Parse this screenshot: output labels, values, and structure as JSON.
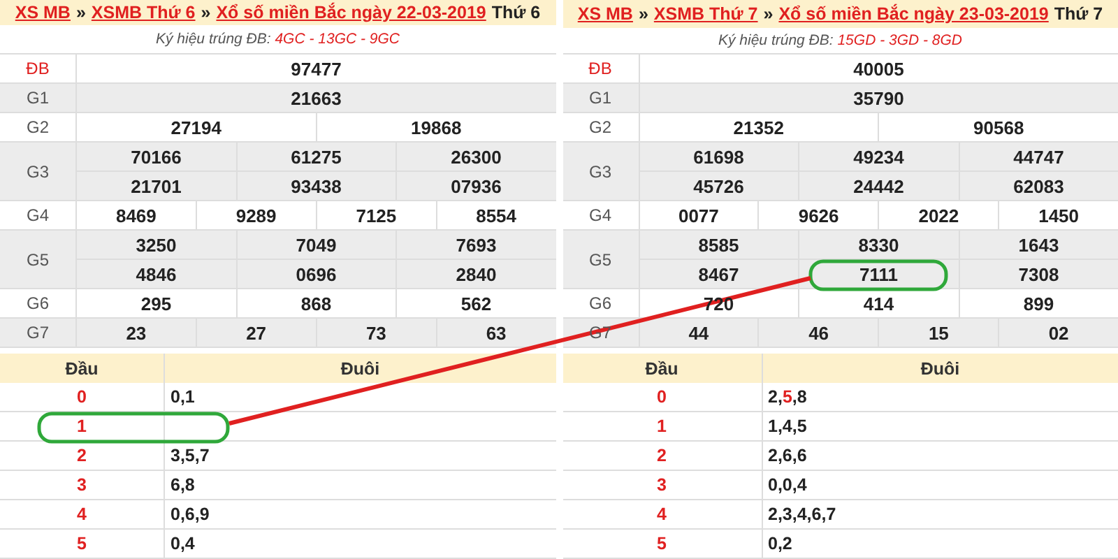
{
  "panels": [
    {
      "breadcrumb": [
        {
          "kind": "link",
          "text": "XS MB"
        },
        {
          "kind": "sep",
          "text": "»"
        },
        {
          "kind": "link",
          "text": "XSMB Thứ 6"
        },
        {
          "kind": "sep",
          "text": "»"
        },
        {
          "kind": "link",
          "text": "Xổ số miền Bắc ngày 22-03-2019"
        },
        {
          "kind": "text",
          "text": "Thứ 6"
        }
      ],
      "code_label": "Ký hiệu trúng ĐB:",
      "codes": "4GC - 13GC - 9GC",
      "prizes": [
        {
          "name": "ĐB",
          "kind": "special",
          "lines": [
            [
              "97477"
            ]
          ]
        },
        {
          "name": "G1",
          "kind": "normal",
          "lines": [
            [
              "21663"
            ]
          ]
        },
        {
          "name": "G2",
          "kind": "normal",
          "lines": [
            [
              "27194",
              "19868"
            ]
          ]
        },
        {
          "name": "G3",
          "kind": "normal",
          "lines": [
            [
              "70166",
              "61275",
              "26300"
            ],
            [
              "21701",
              "93438",
              "07936"
            ]
          ]
        },
        {
          "name": "G4",
          "kind": "normal",
          "lines": [
            [
              "8469",
              "9289",
              "7125",
              "8554"
            ]
          ]
        },
        {
          "name": "G5",
          "kind": "normal",
          "lines": [
            [
              "3250",
              "7049",
              "7693"
            ],
            [
              "4846",
              "0696",
              "2840"
            ]
          ]
        },
        {
          "name": "G6",
          "kind": "normal",
          "lines": [
            [
              "295",
              "868",
              "562"
            ]
          ]
        },
        {
          "name": "G7",
          "kind": "normal",
          "lines": [
            [
              "23",
              "27",
              "73",
              "63"
            ]
          ]
        }
      ],
      "loto": {
        "headers": [
          "Đầu",
          "Đuôi"
        ],
        "rows": [
          {
            "head": "0",
            "tail": [
              {
                "text": "0,1",
                "hit": false
              }
            ]
          },
          {
            "head": "1",
            "tail": []
          },
          {
            "head": "2",
            "tail": [
              {
                "text": "3,5,7",
                "hit": false
              }
            ]
          },
          {
            "head": "3",
            "tail": [
              {
                "text": "6,8",
                "hit": false
              }
            ]
          },
          {
            "head": "4",
            "tail": [
              {
                "text": "0,6,9",
                "hit": false
              }
            ]
          },
          {
            "head": "5",
            "tail": [
              {
                "text": "0,4",
                "hit": false
              }
            ]
          }
        ]
      }
    },
    {
      "breadcrumb": [
        {
          "kind": "link",
          "text": "XS MB"
        },
        {
          "kind": "sep",
          "text": "»"
        },
        {
          "kind": "link",
          "text": "XSMB Thứ 7"
        },
        {
          "kind": "sep",
          "text": "»"
        },
        {
          "kind": "link",
          "text": "Xổ số miền Bắc ngày 23-03-2019"
        },
        {
          "kind": "text",
          "text": "Thứ 7"
        }
      ],
      "code_label": "Ký hiệu trúng ĐB:",
      "codes": "15GD - 3GD - 8GD",
      "prizes": [
        {
          "name": "ĐB",
          "kind": "special",
          "lines": [
            [
              "40005"
            ]
          ]
        },
        {
          "name": "G1",
          "kind": "normal",
          "lines": [
            [
              "35790"
            ]
          ]
        },
        {
          "name": "G2",
          "kind": "normal",
          "lines": [
            [
              "21352",
              "90568"
            ]
          ]
        },
        {
          "name": "G3",
          "kind": "normal",
          "lines": [
            [
              "61698",
              "49234",
              "44747"
            ],
            [
              "45726",
              "24442",
              "62083"
            ]
          ]
        },
        {
          "name": "G4",
          "kind": "normal",
          "lines": [
            [
              "0077",
              "9626",
              "2022",
              "1450"
            ]
          ]
        },
        {
          "name": "G5",
          "kind": "normal",
          "lines": [
            [
              "8585",
              "8330",
              "1643"
            ],
            [
              "8467",
              "7111",
              "7308"
            ]
          ]
        },
        {
          "name": "G6",
          "kind": "normal",
          "lines": [
            [
              "720",
              "414",
              "899"
            ]
          ]
        },
        {
          "name": "G7",
          "kind": "normal",
          "lines": [
            [
              "44",
              "46",
              "15",
              "02"
            ]
          ]
        }
      ],
      "loto": {
        "headers": [
          "Đầu",
          "Đuôi"
        ],
        "rows": [
          {
            "head": "0",
            "tail": [
              {
                "text": "2,",
                "hit": false
              },
              {
                "text": "5",
                "hit": true
              },
              {
                "text": ",8",
                "hit": false
              }
            ]
          },
          {
            "head": "1",
            "tail": [
              {
                "text": "1,4,5",
                "hit": false
              }
            ]
          },
          {
            "head": "2",
            "tail": [
              {
                "text": "2,6,6",
                "hit": false
              }
            ]
          },
          {
            "head": "3",
            "tail": [
              {
                "text": "0,0,4",
                "hit": false
              }
            ]
          },
          {
            "head": "4",
            "tail": [
              {
                "text": "2,3,4,6,7",
                "hit": false
              }
            ]
          },
          {
            "head": "5",
            "tail": [
              {
                "text": "0,2",
                "hit": false
              }
            ]
          }
        ]
      }
    }
  ]
}
